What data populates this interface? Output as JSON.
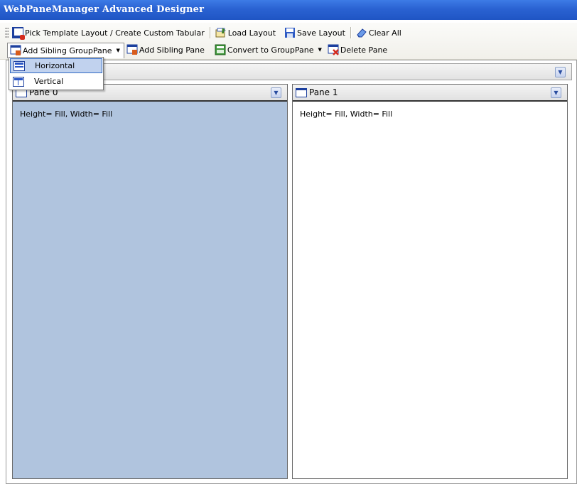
{
  "window": {
    "title": "WebPaneManager Advanced Designer"
  },
  "toolbar": {
    "row1": {
      "pick_template": "Pick Template Layout / Create Custom Tabular",
      "load_layout": "Load Layout",
      "save_layout": "Save Layout",
      "clear_all": "Clear All"
    },
    "row2": {
      "add_sibling_grouppane": "Add Sibling GroupPane",
      "add_sibling_pane": "Add Sibling Pane",
      "convert_to_grouppane": "Convert to GroupPane",
      "delete_pane": "Delete Pane"
    }
  },
  "dropdown": {
    "items": [
      {
        "label": "Horizontal",
        "icon": "horizontal-layout-icon",
        "highlighted": true
      },
      {
        "label": "Vertical",
        "icon": "vertical-layout-icon",
        "highlighted": false
      }
    ]
  },
  "panes": [
    {
      "title": "Pane 0",
      "content": "Height= Fill, Width= Fill",
      "selected": true
    },
    {
      "title": "Pane 1",
      "content": "Height= Fill, Width= Fill",
      "selected": false
    }
  ],
  "colors": {
    "title_bar": "#2a62d2",
    "selected_pane": "#b0c4de",
    "dropdown_highlight": "#c1d2ee"
  }
}
